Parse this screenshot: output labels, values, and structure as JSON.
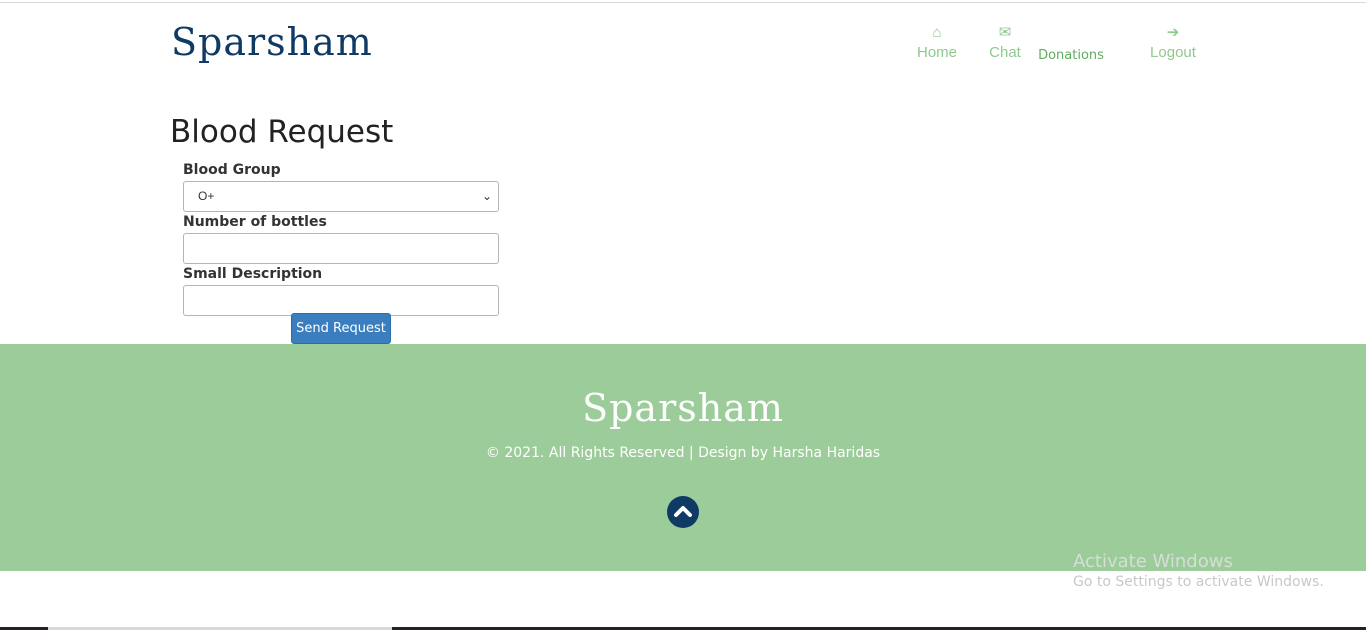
{
  "brand": {
    "name": "Sparsham"
  },
  "nav": {
    "items": [
      {
        "key": "home",
        "label": "Home",
        "icon": "home-icon",
        "glyph": "⌂"
      },
      {
        "key": "chat",
        "label": "Chat",
        "icon": "envelope-icon",
        "glyph": "✉"
      },
      {
        "key": "donations",
        "label": "Donations"
      },
      {
        "key": "logout",
        "label": "Logout",
        "icon": "arrow-right-icon",
        "glyph": "➔"
      }
    ]
  },
  "page": {
    "title": "Blood Request"
  },
  "form": {
    "blood_group": {
      "label": "Blood Group",
      "value": "O+"
    },
    "bottles": {
      "label": "Number of bottles",
      "value": ""
    },
    "description": {
      "label": "Small Description",
      "value": ""
    },
    "submit_label": "Send Request"
  },
  "footer": {
    "brand": "Sparsham",
    "copyright": "© 2021. All Rights Reserved | Design by Harsha Haridas",
    "scroll_top_icon": "chevron-up-icon"
  },
  "watermark": {
    "title": "Activate Windows",
    "subtitle": "Go to Settings to activate Windows."
  },
  "colors": {
    "brand_navy": "#0f3a63",
    "nav_green": "#8fc98f",
    "footer_green": "#9bcc99",
    "button_blue": "#3a7ebf"
  }
}
